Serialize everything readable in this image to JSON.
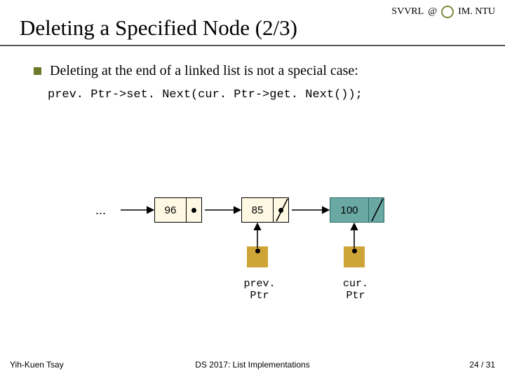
{
  "header": {
    "lab": "SVVRL",
    "sep": "@",
    "org": "IM. NTU"
  },
  "title": "Deleting a Specified Node (2/3)",
  "bullet": "Deleting at the end of a linked list is not a special case:",
  "code": "prev. Ptr->set. Next(cur. Ptr->get. Next());",
  "diagram": {
    "ellipsis": "...",
    "nodes": [
      {
        "value": "96"
      },
      {
        "value": "85"
      },
      {
        "value": "100"
      }
    ],
    "prev_label": "prev. Ptr",
    "cur_label": "cur. Ptr"
  },
  "footer": {
    "author": "Yih-Kuen Tsay",
    "course": "DS 2017: List Implementations",
    "page": "24 / 31"
  }
}
